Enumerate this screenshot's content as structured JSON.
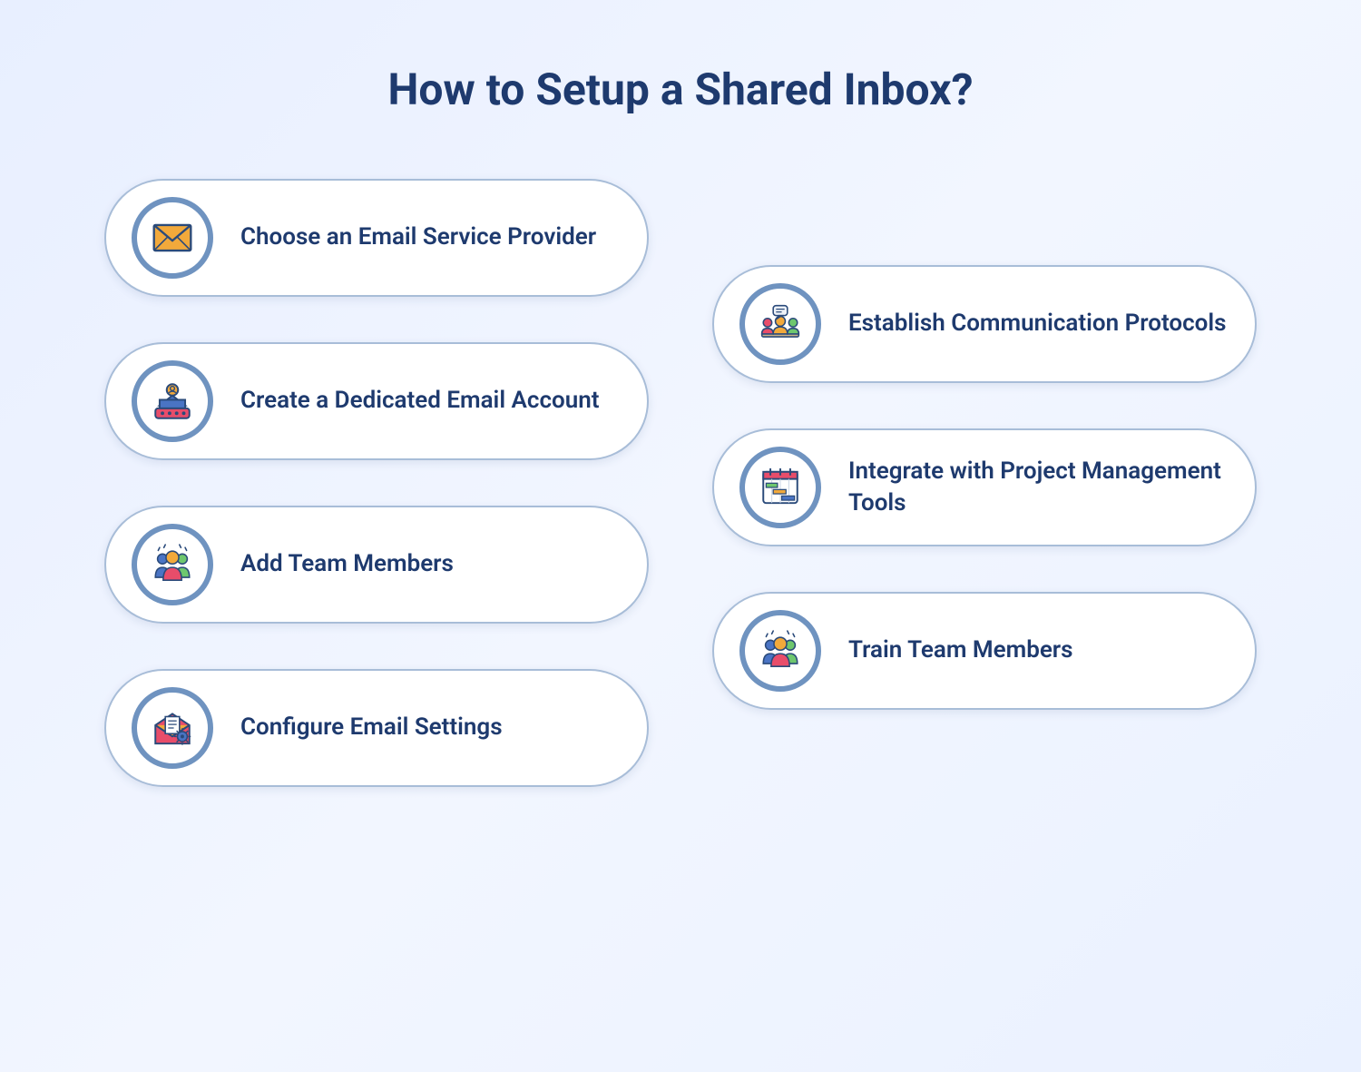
{
  "title": "How to Setup a Shared Inbox?",
  "left_steps": [
    {
      "label": "Choose an Email Service Provider",
      "icon": "envelope"
    },
    {
      "label": "Create a Dedicated Email Account",
      "icon": "account"
    },
    {
      "label": "Add Team Members",
      "icon": "team"
    },
    {
      "label": "Configure Email Settings",
      "icon": "settings"
    }
  ],
  "right_steps": [
    {
      "label": "Establish Communication Protocols",
      "icon": "meeting"
    },
    {
      "label": "Integrate with Project Management Tools",
      "icon": "gantt"
    },
    {
      "label": "Train Team Members",
      "icon": "team"
    }
  ],
  "colors": {
    "heading": "#1e3a6e",
    "card_border": "#a8bdd8",
    "circle_border": "#6f93c0"
  }
}
